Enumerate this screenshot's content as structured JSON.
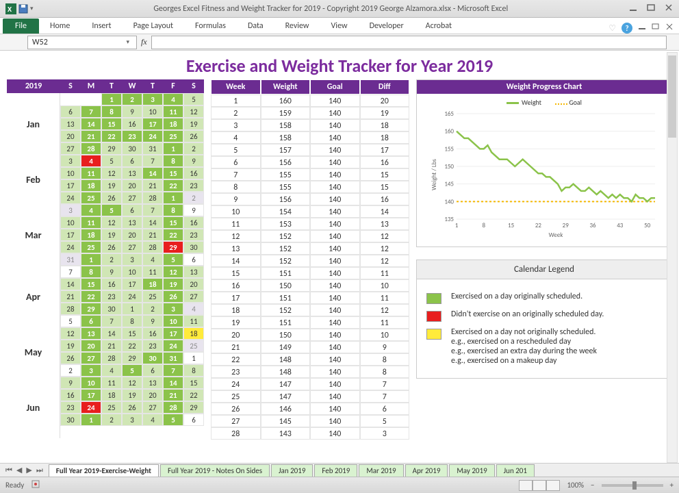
{
  "window": {
    "title": "Georges Excel Fitness and Weight Tracker for 2019 - Copyright 2019 George Alzamora.xlsx - Microsoft Excel"
  },
  "ribbon": {
    "file": "File",
    "tabs": [
      "Home",
      "Insert",
      "Page Layout",
      "Formulas",
      "Data",
      "Review",
      "View",
      "Developer",
      "Acrobat"
    ]
  },
  "namebox": "W52",
  "fx_label": "fx",
  "sheet": {
    "title": "Exercise and Weight Tracker for Year 2019",
    "year": "2019",
    "dow": [
      "S",
      "M",
      "T",
      "W",
      "T",
      "F",
      "S"
    ],
    "months": [
      "Jan",
      "Feb",
      "Mar",
      "Apr",
      "May",
      "Jun"
    ],
    "week_headers": [
      "Week",
      "Weight",
      "Goal",
      "Diff"
    ],
    "week_rows": [
      {
        "w": "1",
        "wt": "160",
        "g": "140",
        "d": "20"
      },
      {
        "w": "2",
        "wt": "159",
        "g": "140",
        "d": "19"
      },
      {
        "w": "3",
        "wt": "158",
        "g": "140",
        "d": "18"
      },
      {
        "w": "4",
        "wt": "158",
        "g": "140",
        "d": "18"
      },
      {
        "w": "5",
        "wt": "157",
        "g": "140",
        "d": "17"
      },
      {
        "w": "6",
        "wt": "156",
        "g": "140",
        "d": "16"
      },
      {
        "w": "7",
        "wt": "155",
        "g": "140",
        "d": "15"
      },
      {
        "w": "8",
        "wt": "155",
        "g": "140",
        "d": "15"
      },
      {
        "w": "9",
        "wt": "156",
        "g": "140",
        "d": "16"
      },
      {
        "w": "10",
        "wt": "154",
        "g": "140",
        "d": "14"
      },
      {
        "w": "11",
        "wt": "153",
        "g": "140",
        "d": "13"
      },
      {
        "w": "12",
        "wt": "152",
        "g": "140",
        "d": "12"
      },
      {
        "w": "13",
        "wt": "152",
        "g": "140",
        "d": "12"
      },
      {
        "w": "14",
        "wt": "152",
        "g": "140",
        "d": "12"
      },
      {
        "w": "15",
        "wt": "151",
        "g": "140",
        "d": "11"
      },
      {
        "w": "16",
        "wt": "150",
        "g": "140",
        "d": "10"
      },
      {
        "w": "17",
        "wt": "151",
        "g": "140",
        "d": "11"
      },
      {
        "w": "18",
        "wt": "152",
        "g": "140",
        "d": "12"
      },
      {
        "w": "19",
        "wt": "151",
        "g": "140",
        "d": "11"
      },
      {
        "w": "20",
        "wt": "150",
        "g": "140",
        "d": "10"
      },
      {
        "w": "21",
        "wt": "149",
        "g": "140",
        "d": "9"
      },
      {
        "w": "22",
        "wt": "148",
        "g": "140",
        "d": "8"
      },
      {
        "w": "23",
        "wt": "148",
        "g": "140",
        "d": "8"
      },
      {
        "w": "24",
        "wt": "147",
        "g": "140",
        "d": "7"
      },
      {
        "w": "25",
        "wt": "147",
        "g": "140",
        "d": "7"
      },
      {
        "w": "26",
        "wt": "146",
        "g": "140",
        "d": "6"
      },
      {
        "w": "27",
        "wt": "145",
        "g": "140",
        "d": "5"
      },
      {
        "w": "28",
        "wt": "143",
        "g": "140",
        "d": "3"
      }
    ],
    "chart": {
      "title": "Weight Progress Chart",
      "legend_weight": "Weight",
      "legend_goal": "Goal",
      "ylabel": "Weight / Lbs",
      "xlabel": "Week",
      "yticks": [
        "165",
        "160",
        "155",
        "150",
        "145",
        "140",
        "135"
      ],
      "xticks": [
        "1",
        "8",
        "15",
        "22",
        "29",
        "36",
        "43",
        "50"
      ]
    },
    "legend": {
      "title": "Calendar Legend",
      "g": "Exercised on a day originally scheduled.",
      "r": "Didn't exercise on an originally scheduled day.",
      "y": "Exercised on a day not originally scheduled.",
      "y1": "e.g., exercised on a rescheduled day",
      "y2": "e.g., exercised an extra day during the week",
      "y3": "e.g., exercised on a makeup day"
    },
    "cal_rows": [
      [
        [
          "",
          ""
        ],
        [
          "",
          ""
        ],
        [
          "1",
          "g"
        ],
        [
          "2",
          "g"
        ],
        [
          "3",
          "g"
        ],
        [
          "4",
          "g"
        ],
        [
          "5",
          "gl"
        ]
      ],
      [
        [
          "6",
          "gl"
        ],
        [
          "7",
          "g"
        ],
        [
          "8",
          "g"
        ],
        [
          "9",
          "gl"
        ],
        [
          "10",
          "gl"
        ],
        [
          "11",
          "g"
        ],
        [
          "12",
          "gl"
        ]
      ],
      [
        [
          "13",
          "gl"
        ],
        [
          "14",
          "g"
        ],
        [
          "15",
          "g"
        ],
        [
          "16",
          "gl"
        ],
        [
          "17",
          "g"
        ],
        [
          "18",
          "g"
        ],
        [
          "19",
          "gl"
        ]
      ],
      [
        [
          "20",
          "gl"
        ],
        [
          "21",
          "g"
        ],
        [
          "22",
          "g"
        ],
        [
          "23",
          "g"
        ],
        [
          "24",
          "g"
        ],
        [
          "25",
          "g"
        ],
        [
          "26",
          "gl"
        ]
      ],
      [
        [
          "27",
          "gl"
        ],
        [
          "28",
          "g"
        ],
        [
          "29",
          "gl"
        ],
        [
          "30",
          "gl"
        ],
        [
          "31",
          "gl"
        ],
        [
          "1",
          "g"
        ],
        [
          "2",
          "gl"
        ]
      ],
      [
        [
          "3",
          "gl"
        ],
        [
          "4",
          "r"
        ],
        [
          "5",
          "gl"
        ],
        [
          "6",
          "gl"
        ],
        [
          "7",
          "gl"
        ],
        [
          "8",
          "g"
        ],
        [
          "9",
          "gl"
        ]
      ],
      [
        [
          "10",
          "gl"
        ],
        [
          "11",
          "g"
        ],
        [
          "12",
          "gl"
        ],
        [
          "13",
          "gl"
        ],
        [
          "14",
          "g"
        ],
        [
          "15",
          "g"
        ],
        [
          "16",
          "gl"
        ]
      ],
      [
        [
          "17",
          "gl"
        ],
        [
          "18",
          "g"
        ],
        [
          "19",
          "gl"
        ],
        [
          "20",
          "gl"
        ],
        [
          "21",
          "gl"
        ],
        [
          "22",
          "g"
        ],
        [
          "23",
          "gl"
        ]
      ],
      [
        [
          "24",
          "gl"
        ],
        [
          "25",
          "g"
        ],
        [
          "26",
          "gl"
        ],
        [
          "27",
          "gl"
        ],
        [
          "28",
          "gl"
        ],
        [
          "1",
          "g"
        ],
        [
          "2",
          "dim"
        ]
      ],
      [
        [
          "3",
          "dim"
        ],
        [
          "4",
          "g"
        ],
        [
          "5",
          "g"
        ],
        [
          "6",
          "gl"
        ],
        [
          "7",
          "gl"
        ],
        [
          "8",
          "g"
        ],
        [
          "9",
          ""
        ]
      ],
      [
        [
          "10",
          "gl"
        ],
        [
          "11",
          "g"
        ],
        [
          "12",
          "gl"
        ],
        [
          "13",
          "gl"
        ],
        [
          "14",
          "gl"
        ],
        [
          "15",
          "g"
        ],
        [
          "16",
          "gl"
        ]
      ],
      [
        [
          "17",
          "gl"
        ],
        [
          "18",
          "g"
        ],
        [
          "19",
          "gl"
        ],
        [
          "20",
          "gl"
        ],
        [
          "21",
          "gl"
        ],
        [
          "22",
          "g"
        ],
        [
          "23",
          "gl"
        ]
      ],
      [
        [
          "24",
          "gl"
        ],
        [
          "25",
          "g"
        ],
        [
          "26",
          "gl"
        ],
        [
          "27",
          "gl"
        ],
        [
          "28",
          "gl"
        ],
        [
          "29",
          "r"
        ],
        [
          "30",
          "gl"
        ]
      ],
      [
        [
          "31",
          "dim"
        ],
        [
          "1",
          "g"
        ],
        [
          "2",
          "gl"
        ],
        [
          "3",
          "gl"
        ],
        [
          "4",
          "gl"
        ],
        [
          "5",
          "g"
        ],
        [
          "6",
          ""
        ]
      ],
      [
        [
          "7",
          ""
        ],
        [
          "8",
          "g"
        ],
        [
          "9",
          "gl"
        ],
        [
          "10",
          "gl"
        ],
        [
          "11",
          "gl"
        ],
        [
          "12",
          "g"
        ],
        [
          "13",
          "gl"
        ]
      ],
      [
        [
          "14",
          "gl"
        ],
        [
          "15",
          "g"
        ],
        [
          "16",
          "gl"
        ],
        [
          "17",
          "gl"
        ],
        [
          "18",
          "g"
        ],
        [
          "19",
          "g"
        ],
        [
          "20",
          "gl"
        ]
      ],
      [
        [
          "21",
          "gl"
        ],
        [
          "22",
          "g"
        ],
        [
          "23",
          "gl"
        ],
        [
          "24",
          "gl"
        ],
        [
          "25",
          "gl"
        ],
        [
          "26",
          "g"
        ],
        [
          "27",
          "gl"
        ]
      ],
      [
        [
          "28",
          "gl"
        ],
        [
          "29",
          "g"
        ],
        [
          "30",
          "gl"
        ],
        [
          "1",
          "gl"
        ],
        [
          "2",
          "gl"
        ],
        [
          "3",
          "g"
        ],
        [
          "4",
          "dim"
        ]
      ],
      [
        [
          "5",
          ""
        ],
        [
          "6",
          "g"
        ],
        [
          "7",
          "gl"
        ],
        [
          "8",
          "gl"
        ],
        [
          "9",
          "gl"
        ],
        [
          "10",
          "g"
        ],
        [
          "11",
          "gl"
        ]
      ],
      [
        [
          "12",
          "gl"
        ],
        [
          "13",
          "g"
        ],
        [
          "14",
          "gl"
        ],
        [
          "15",
          "gl"
        ],
        [
          "16",
          "gl"
        ],
        [
          "17",
          "g"
        ],
        [
          "18",
          "y"
        ]
      ],
      [
        [
          "19",
          "gl"
        ],
        [
          "20",
          "g"
        ],
        [
          "21",
          "gl"
        ],
        [
          "22",
          "gl"
        ],
        [
          "23",
          "gl"
        ],
        [
          "24",
          "g"
        ],
        [
          "25",
          "dim"
        ]
      ],
      [
        [
          "26",
          "gl"
        ],
        [
          "27",
          "g"
        ],
        [
          "28",
          "gl"
        ],
        [
          "29",
          "gl"
        ],
        [
          "30",
          "g"
        ],
        [
          "31",
          "g"
        ],
        [
          "1",
          ""
        ]
      ],
      [
        [
          "2",
          ""
        ],
        [
          "3",
          "g"
        ],
        [
          "4",
          "gl"
        ],
        [
          "5",
          "g"
        ],
        [
          "6",
          "gl"
        ],
        [
          "7",
          "g"
        ],
        [
          "8",
          "gl"
        ]
      ],
      [
        [
          "9",
          "gl"
        ],
        [
          "10",
          "g"
        ],
        [
          "11",
          "gl"
        ],
        [
          "12",
          "gl"
        ],
        [
          "13",
          "gl"
        ],
        [
          "14",
          "g"
        ],
        [
          "15",
          "gl"
        ]
      ],
      [
        [
          "16",
          "gl"
        ],
        [
          "17",
          "g"
        ],
        [
          "18",
          "gl"
        ],
        [
          "19",
          "gl"
        ],
        [
          "20",
          "gl"
        ],
        [
          "21",
          "g"
        ],
        [
          "22",
          "gl"
        ]
      ],
      [
        [
          "23",
          "gl"
        ],
        [
          "24",
          "r"
        ],
        [
          "25",
          "gl"
        ],
        [
          "26",
          "gl"
        ],
        [
          "27",
          "gl"
        ],
        [
          "28",
          "g"
        ],
        [
          "29",
          "gl"
        ]
      ],
      [
        [
          "30",
          "gl"
        ],
        [
          "1",
          "g"
        ],
        [
          "2",
          "gl"
        ],
        [
          "3",
          "gl"
        ],
        [
          "4",
          "gl"
        ],
        [
          "5",
          "g"
        ],
        [
          "6",
          ""
        ]
      ]
    ]
  },
  "tabs": [
    "Full Year 2019-Exercise-Weight",
    "Full Year 2019 - Notes On Sides",
    "Jan 2019",
    "Feb 2019",
    "Mar 2019",
    "Apr 2019",
    "May 2019",
    "Jun 201"
  ],
  "status": {
    "ready": "Ready",
    "zoom": "100%"
  },
  "chart_data": {
    "type": "line",
    "title": "Weight Progress Chart",
    "xlabel": "Week",
    "ylabel": "Weight / Lbs",
    "ylim": [
      135,
      165
    ],
    "xlim": [
      1,
      52
    ],
    "series": [
      {
        "name": "Weight",
        "x": [
          1,
          2,
          3,
          4,
          5,
          6,
          7,
          8,
          9,
          10,
          11,
          12,
          13,
          14,
          15,
          16,
          17,
          18,
          19,
          20,
          21,
          22,
          23,
          24,
          25,
          26,
          27,
          28,
          29,
          30,
          31,
          32,
          33,
          34,
          35,
          36,
          37,
          38,
          39,
          40,
          41,
          42,
          43,
          44,
          45,
          46,
          47,
          48,
          49,
          50,
          51,
          52
        ],
        "values": [
          160,
          159,
          158,
          158,
          157,
          156,
          155,
          155,
          156,
          154,
          153,
          152,
          152,
          152,
          151,
          150,
          151,
          152,
          151,
          150,
          149,
          148,
          148,
          147,
          147,
          146,
          145,
          143,
          144,
          144,
          145,
          144,
          143,
          143,
          144,
          143,
          142,
          143,
          142,
          141,
          142,
          141,
          142,
          141,
          141,
          140,
          142,
          141,
          141,
          140,
          141,
          141
        ]
      },
      {
        "name": "Goal",
        "x": [
          1,
          52
        ],
        "values": [
          140,
          140
        ]
      }
    ]
  }
}
